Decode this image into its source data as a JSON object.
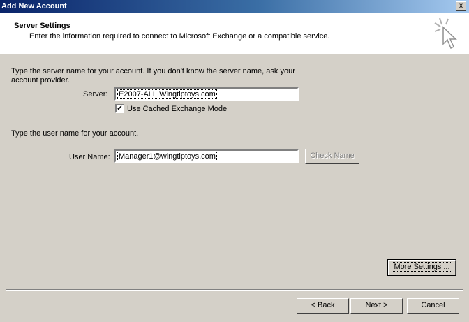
{
  "window": {
    "title": "Add New Account",
    "close_label": "x"
  },
  "header": {
    "title": "Server Settings",
    "subtitle": "Enter the information required to connect to Microsoft Exchange or a compatible service."
  },
  "server_section": {
    "instruction_line1": "Type the server name for your account. If you don't know the server name, ask your",
    "instruction_line2": "account provider.",
    "server_label": "Server:",
    "server_value": "E2007-ALL.Wingtiptoys.com",
    "cached_mode_label": "Use Cached Exchange Mode",
    "cached_mode_checked": true
  },
  "user_section": {
    "instruction": "Type the user name for your account.",
    "user_label": "User Name:",
    "user_value": "Manager1@wingtiptoys.com",
    "check_name_label": "Check Name"
  },
  "buttons": {
    "more_settings": "More Settings ...",
    "back": "< Back",
    "next": "Next >",
    "cancel": "Cancel"
  }
}
